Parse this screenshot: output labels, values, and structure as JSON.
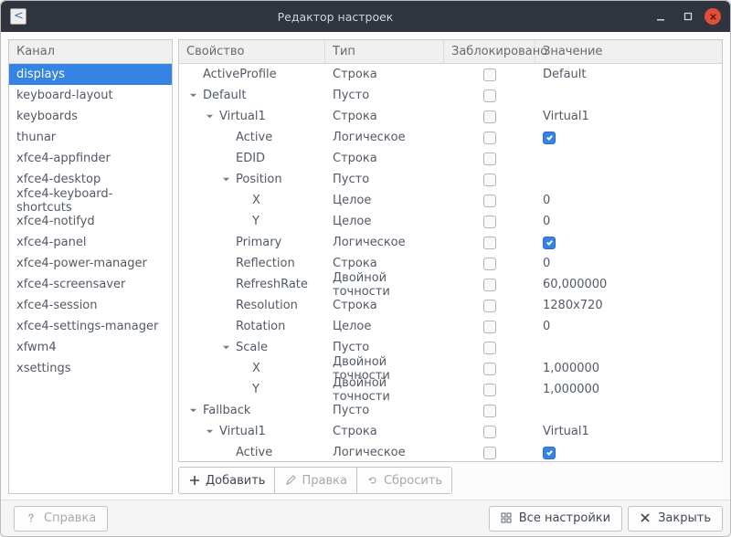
{
  "window": {
    "title": "Редактор настроек"
  },
  "sidebar": {
    "header": "Канал",
    "items": [
      "displays",
      "keyboard-layout",
      "keyboards",
      "thunar",
      "xfce4-appfinder",
      "xfce4-desktop",
      "xfce4-keyboard-shortcuts",
      "xfce4-notifyd",
      "xfce4-panel",
      "xfce4-power-manager",
      "xfce4-screensaver",
      "xfce4-session",
      "xfce4-settings-manager",
      "xfwm4",
      "xsettings"
    ],
    "selected": 0
  },
  "tree": {
    "columns": {
      "property": "Свойство",
      "type": "Тип",
      "locked": "Заблокировано",
      "value": "Значение"
    },
    "rows": [
      {
        "depth": 0,
        "expander": "",
        "property": "ActiveProfile",
        "type": "Строка",
        "locked": false,
        "value": "Default"
      },
      {
        "depth": 0,
        "expander": "down",
        "property": "Default",
        "type": "Пусто",
        "locked": false,
        "value": ""
      },
      {
        "depth": 1,
        "expander": "down",
        "property": "Virtual1",
        "type": "Строка",
        "locked": false,
        "value": "Virtual1"
      },
      {
        "depth": 2,
        "expander": "",
        "property": "Active",
        "type": "Логическое",
        "locked": false,
        "value": "__check_true"
      },
      {
        "depth": 2,
        "expander": "",
        "property": "EDID",
        "type": "Строка",
        "locked": false,
        "value": ""
      },
      {
        "depth": 2,
        "expander": "down",
        "property": "Position",
        "type": "Пусто",
        "locked": false,
        "value": ""
      },
      {
        "depth": 3,
        "expander": "",
        "property": "X",
        "type": "Целое",
        "locked": false,
        "value": "0"
      },
      {
        "depth": 3,
        "expander": "",
        "property": "Y",
        "type": "Целое",
        "locked": false,
        "value": "0"
      },
      {
        "depth": 2,
        "expander": "",
        "property": "Primary",
        "type": "Логическое",
        "locked": false,
        "value": "__check_true"
      },
      {
        "depth": 2,
        "expander": "",
        "property": "Reflection",
        "type": "Строка",
        "locked": false,
        "value": "0"
      },
      {
        "depth": 2,
        "expander": "",
        "property": "RefreshRate",
        "type": "Двойной точности",
        "locked": false,
        "value": "60,000000"
      },
      {
        "depth": 2,
        "expander": "",
        "property": "Resolution",
        "type": "Строка",
        "locked": false,
        "value": "1280x720"
      },
      {
        "depth": 2,
        "expander": "",
        "property": "Rotation",
        "type": "Целое",
        "locked": false,
        "value": "0"
      },
      {
        "depth": 2,
        "expander": "down",
        "property": "Scale",
        "type": "Пусто",
        "locked": false,
        "value": ""
      },
      {
        "depth": 3,
        "expander": "",
        "property": "X",
        "type": "Двойной точности",
        "locked": false,
        "value": "1,000000"
      },
      {
        "depth": 3,
        "expander": "",
        "property": "Y",
        "type": "Двойной точности",
        "locked": false,
        "value": "1,000000"
      },
      {
        "depth": 0,
        "expander": "down",
        "property": "Fallback",
        "type": "Пусто",
        "locked": false,
        "value": ""
      },
      {
        "depth": 1,
        "expander": "down",
        "property": "Virtual1",
        "type": "Строка",
        "locked": false,
        "value": "Virtual1"
      },
      {
        "depth": 2,
        "expander": "",
        "property": "Active",
        "type": "Логическое",
        "locked": false,
        "value": "__check_true"
      }
    ]
  },
  "toolbar": {
    "add": "Добавить",
    "edit": "Правка",
    "reset": "Сбросить"
  },
  "footer": {
    "help": "Справка",
    "all_settings": "Все настройки",
    "close": "Закрыть"
  }
}
